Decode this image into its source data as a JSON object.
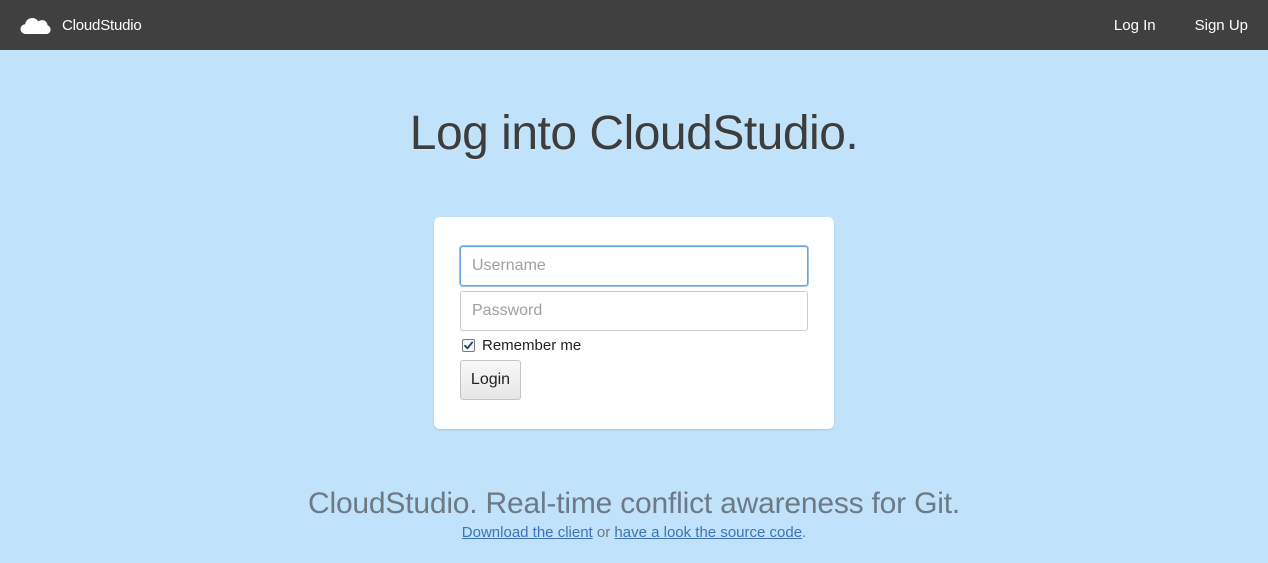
{
  "navbar": {
    "brand_icon": "cloud-icon",
    "brand_name": "CloudStudio",
    "links": [
      {
        "label": "Log In"
      },
      {
        "label": "Sign Up"
      }
    ],
    "background_color": "#404040"
  },
  "main": {
    "title": "Log into CloudStudio.",
    "background_color": "#c0e2fa"
  },
  "login_form": {
    "username": {
      "value": "",
      "placeholder": "Username",
      "focused": true
    },
    "password": {
      "value": "",
      "placeholder": "Password"
    },
    "remember_me": {
      "label": "Remember me",
      "checked": true
    },
    "submit_label": "Login"
  },
  "footer": {
    "tagline": "CloudStudio. Real-time conflict awareness for Git.",
    "download_link": "Download the client",
    "separator": "or",
    "source_link": "have a look the source code",
    "end": "."
  }
}
